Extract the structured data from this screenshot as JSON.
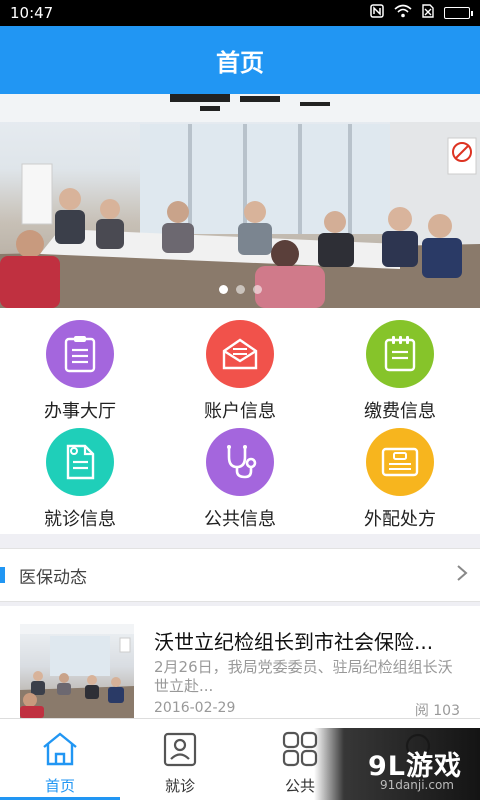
{
  "status": {
    "time": "10:47"
  },
  "header": {
    "title": "首页"
  },
  "banner": {
    "slides": 3,
    "active_slide": 1
  },
  "grid": {
    "items": [
      {
        "label": "办事大厅",
        "icon": "clipboard-icon",
        "color": "#a466dd"
      },
      {
        "label": "账户信息",
        "icon": "envelope-icon",
        "color": "#f1524b"
      },
      {
        "label": "缴费信息",
        "icon": "notepad-icon",
        "color": "#86c42a"
      },
      {
        "label": "就诊信息",
        "icon": "document-icon",
        "color": "#1fcfb9"
      },
      {
        "label": "公共信息",
        "icon": "stethoscope-icon",
        "color": "#a466dd"
      },
      {
        "label": "外配处方",
        "icon": "card-icon",
        "color": "#f7b51e"
      }
    ]
  },
  "news": {
    "section_title": "医保动态",
    "items": [
      {
        "title": "沃世立纪检组长到市社会保险...",
        "summary": "2月26日，我局党委委员、驻局纪检组组长沃世立赴...",
        "date": "2016-02-29",
        "reads": "阅 103"
      }
    ]
  },
  "tabbar": {
    "tabs": [
      {
        "label": "首页",
        "icon": "home-icon",
        "active": true
      },
      {
        "label": "就诊",
        "icon": "profile-card-icon",
        "active": false
      },
      {
        "label": "公共",
        "icon": "grid-icon",
        "active": false
      },
      {
        "label": "",
        "icon": "search-icon",
        "active": false
      }
    ]
  },
  "watermark": {
    "logo": "9L游戏",
    "url": "91danji.com"
  },
  "colors": {
    "primary": "#2196f3"
  }
}
